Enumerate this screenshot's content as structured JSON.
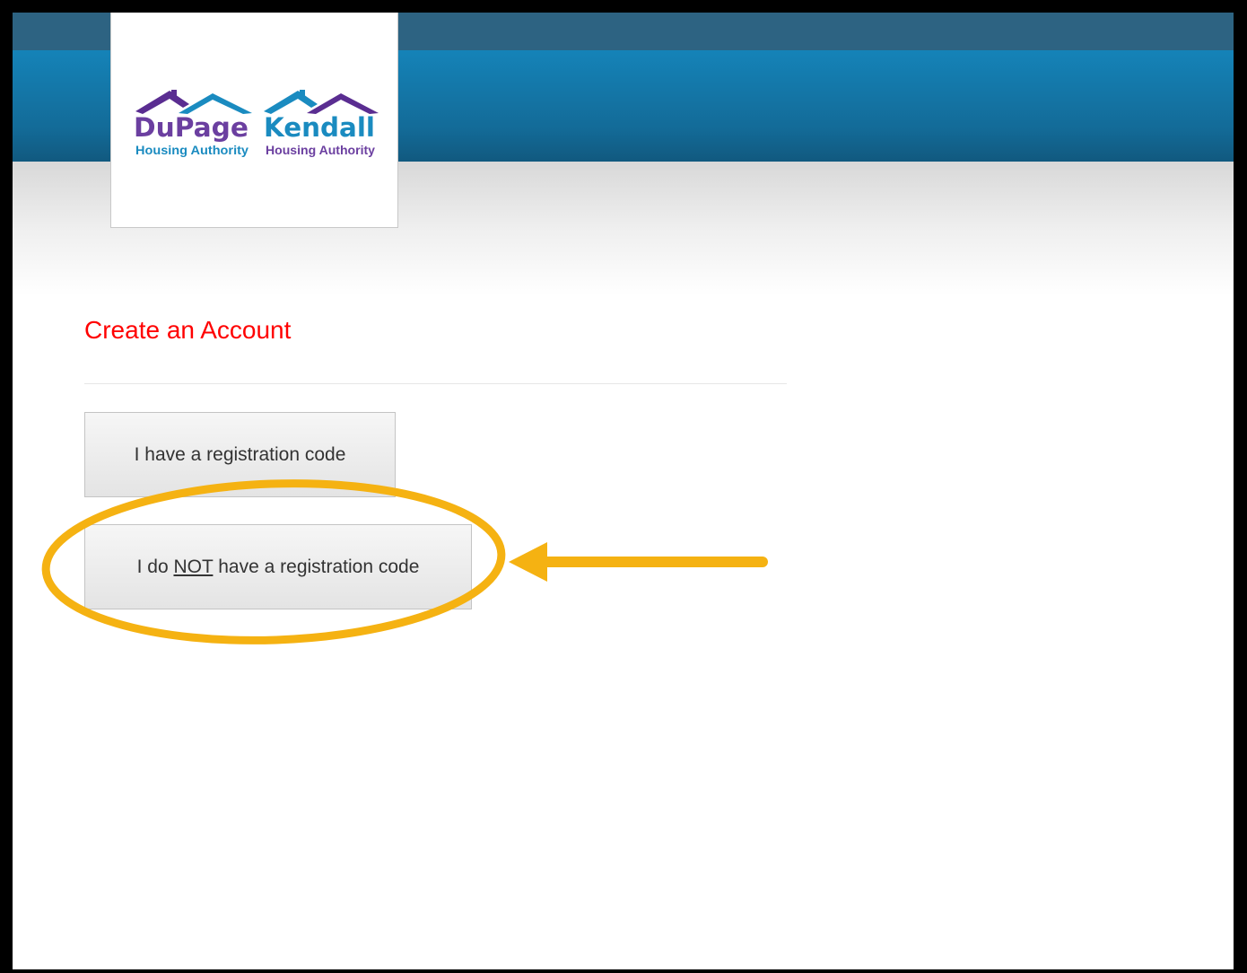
{
  "header": {
    "logos": [
      {
        "icon": "dupage-house-roof-icon",
        "name": "DuPage",
        "subtitle": "Housing Authority",
        "name_color": "#6b3fa0",
        "subtitle_color": "#1a8bc0"
      },
      {
        "icon": "kendall-house-roof-icon",
        "name": "Kendall",
        "subtitle": "Housing Authority",
        "name_color": "#1a8bc0",
        "subtitle_color": "#6b3fa0"
      }
    ]
  },
  "main": {
    "title": "Create an Account",
    "title_color": "#ff0000",
    "buttons": {
      "have_code": "I have a registration code",
      "no_code": {
        "prefix": "I do ",
        "emphasis": "NOT",
        "suffix": " have a registration code"
      }
    }
  },
  "annotation": {
    "highlight_target": "I do NOT have a registration code",
    "color": "#f5b212",
    "shapes": [
      "highlight-ellipse",
      "pointer-arrow"
    ]
  }
}
